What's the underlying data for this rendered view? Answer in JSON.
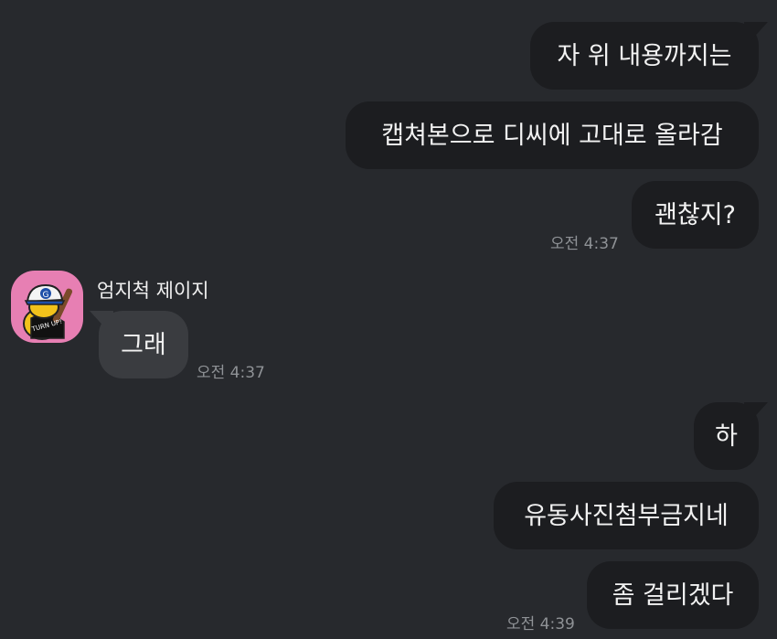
{
  "chat": {
    "outgoing_group_1": [
      {
        "text": "자 위 내용까지는"
      },
      {
        "text": "캡쳐본으로 디씨에 고대로 올라감"
      },
      {
        "text": "괜찮지?"
      }
    ],
    "outgoing_group_1_time": "오전 4:37",
    "incoming": {
      "sender_name": "엄지척 제이지",
      "avatar_caption": "TURN UP!",
      "avatar_cap_letter": "G",
      "messages": [
        {
          "text": "그래"
        }
      ],
      "time": "오전 4:37"
    },
    "outgoing_group_2": [
      {
        "text": "하"
      },
      {
        "text": "유동사진첨부금지네"
      },
      {
        "text": "좀 걸리겠다"
      }
    ],
    "outgoing_group_2_time": "오전 4:39"
  },
  "colors": {
    "background": "#27292d",
    "outgoing_bubble": "#1c1d20",
    "incoming_bubble": "#3a3c40",
    "avatar_bg": "#e77fb3",
    "timestamp": "#8f9296"
  }
}
